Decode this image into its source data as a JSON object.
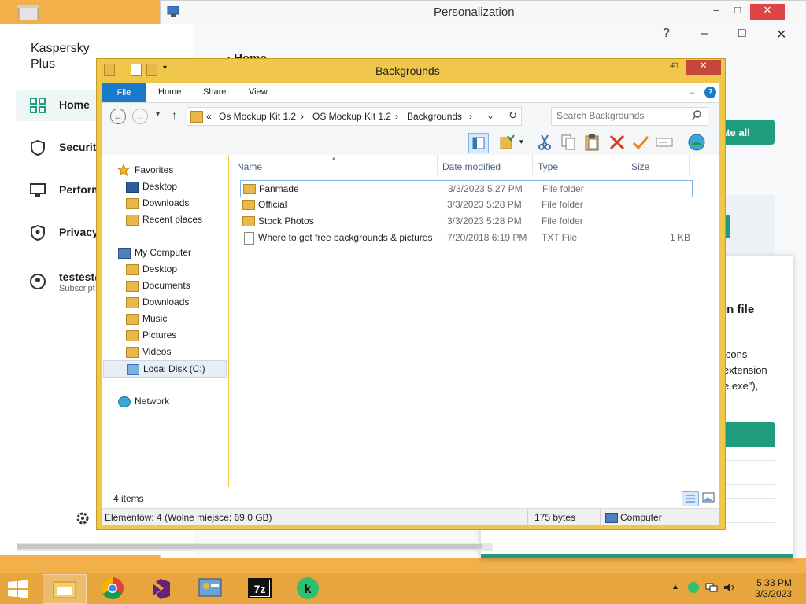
{
  "personalization": {
    "title": "Personalization",
    "help": "?",
    "min": "–",
    "max": "□",
    "close": "✕"
  },
  "kaspersky": {
    "brand_line1": "Kaspersky",
    "brand_line2": "Plus",
    "back_label": "‹ Home",
    "nav": [
      {
        "label": "Home",
        "icon": "home-grid-icon"
      },
      {
        "label": "Security",
        "icon": "shield-icon"
      },
      {
        "label": "Perform",
        "icon": "monitor-icon"
      },
      {
        "label": "Privacy",
        "icon": "privacy-shield-icon"
      }
    ],
    "account": {
      "user": "testest@",
      "sub": "Subscript"
    },
    "update_button": "ate all",
    "dialog": {
      "heading": "in file",
      "line1": "icons",
      "line2": "extension",
      "line3": "e.exe\"),",
      "win_min": "–",
      "win_max": "□",
      "win_close": "✕"
    },
    "accent": "#1f9b7e"
  },
  "explorer": {
    "title": "Backgrounds",
    "ribbon_tabs": [
      "File",
      "Home",
      "Share",
      "View"
    ],
    "breadcrumb": [
      "«",
      "Os Mockup Kit 1.2",
      "›",
      "OS Mockup Kit 1.2",
      "›",
      "Backgrounds",
      "›"
    ],
    "search_placeholder": "Search Backgrounds",
    "columns": {
      "name": "Name",
      "date": "Date modified",
      "type": "Type",
      "size": "Size"
    },
    "files": [
      {
        "name": "Fanmade",
        "date": "3/3/2023 5:27 PM",
        "type": "File folder",
        "size": "",
        "icon": "folder-icon"
      },
      {
        "name": "Official",
        "date": "3/3/2023 5:28 PM",
        "type": "File folder",
        "size": "",
        "icon": "folder-icon"
      },
      {
        "name": "Stock Photos",
        "date": "3/3/2023 5:28 PM",
        "type": "File folder",
        "size": "",
        "icon": "folder-icon"
      },
      {
        "name": "Where to get free backgrounds & pictures",
        "date": "7/20/2018 6:19 PM",
        "type": "TXT File",
        "size": "1 KB",
        "icon": "text-file-icon"
      }
    ],
    "nav_pane": {
      "favorites": "Favorites",
      "fav_items": [
        "Desktop",
        "Downloads",
        "Recent places"
      ],
      "computer": "My Computer",
      "computer_items": [
        "Desktop",
        "Documents",
        "Downloads",
        "Music",
        "Pictures",
        "Videos",
        "Local Disk (C:)"
      ],
      "network": "Network"
    },
    "item_count": "4 items",
    "status_left": "Elementów: 4 (Wolne miejsce: 69.0 GB)",
    "status_size": "175 bytes",
    "status_location": "Computer"
  },
  "taskbar": {
    "time": "5:33 PM",
    "date": "3/3/2023",
    "apps": [
      "file-explorer-icon",
      "chrome-icon",
      "visual-studio-icon",
      "control-panel-icon",
      "7zip-icon",
      "kaspersky-icon"
    ]
  }
}
